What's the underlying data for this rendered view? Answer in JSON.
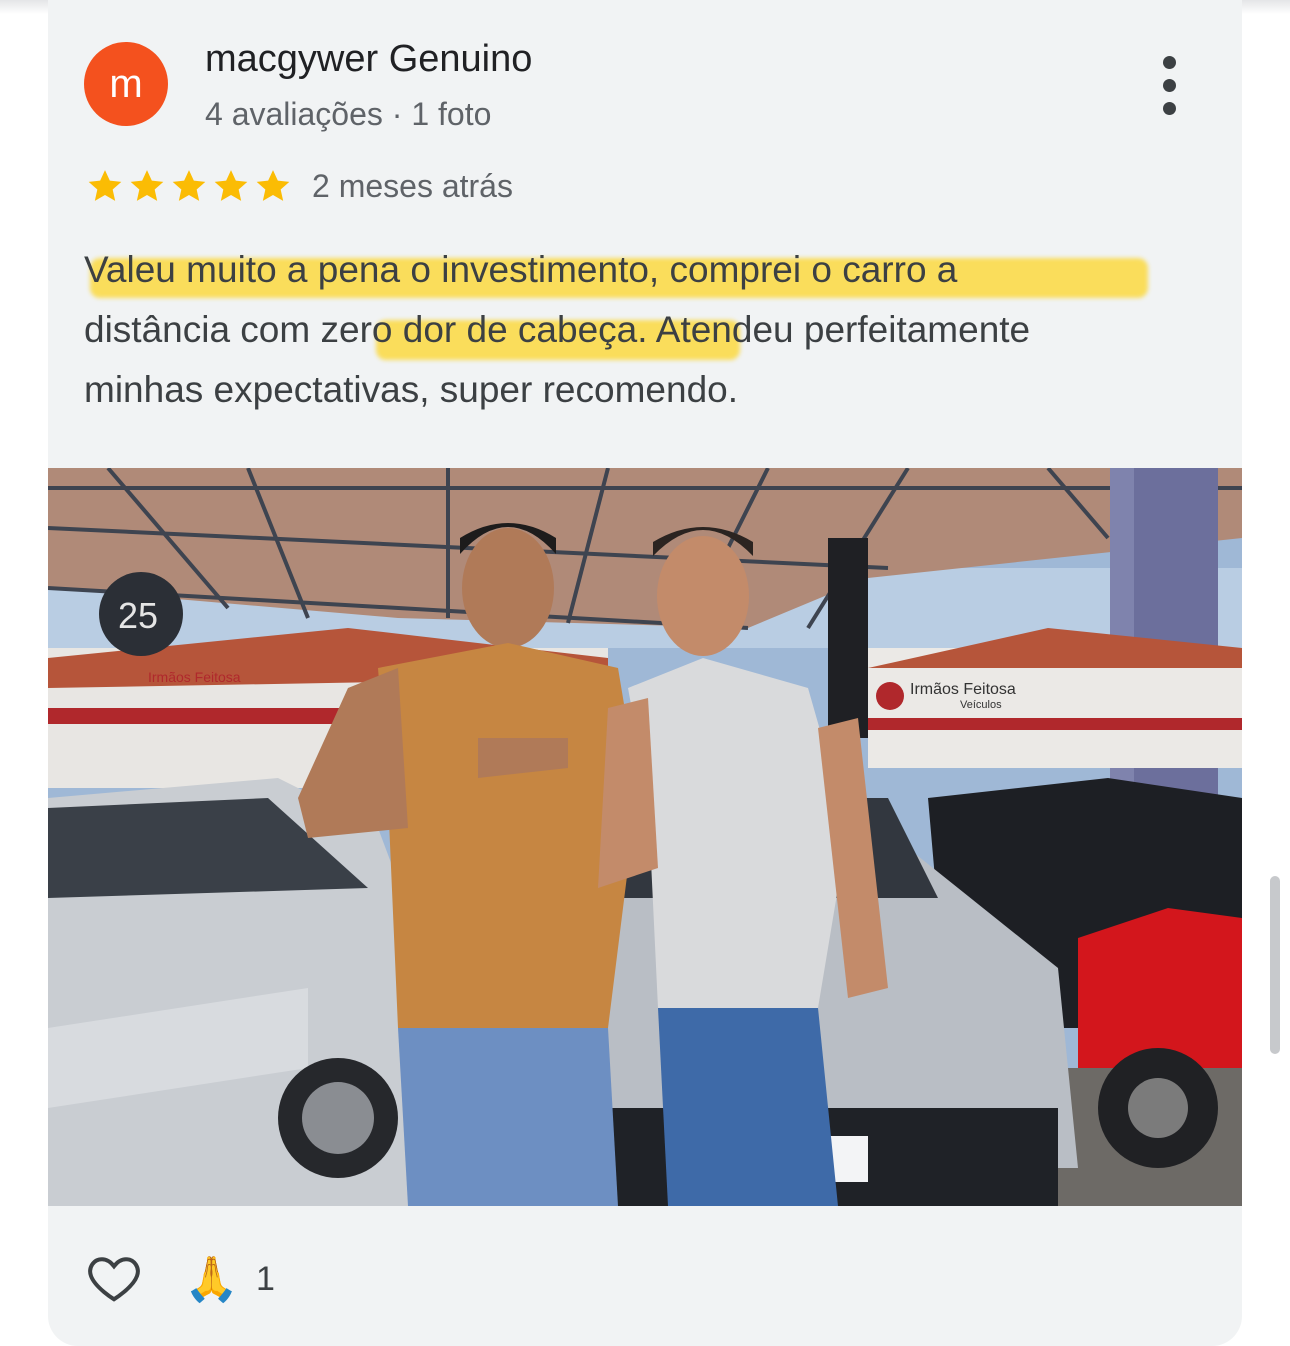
{
  "review": {
    "author": "macgywer Genuino",
    "avatar_letter": "m",
    "avatar_color": "#f4511e",
    "meta": "4 avaliações · 1 foto",
    "rating": 5,
    "date": "2 meses atrás",
    "text_lines": [
      "Valeu muito a pena o investimento, comprei o carro a",
      "distância com zero dor de cabeça. Atendeu perfeitamente",
      "minhas expectativas, super recomendo."
    ],
    "highlight_color": "#fcd628",
    "star_color": "#fbbc04"
  },
  "photo": {
    "sign_left": "Irmãos Feitosa",
    "sign_right": "Irmãos Feitosa",
    "sign_right_sub": "Veículos",
    "badge": "25"
  },
  "actions": {
    "like_icon": "heart-outline-icon",
    "reaction_emoji": "🙏",
    "reaction_count": "1"
  }
}
